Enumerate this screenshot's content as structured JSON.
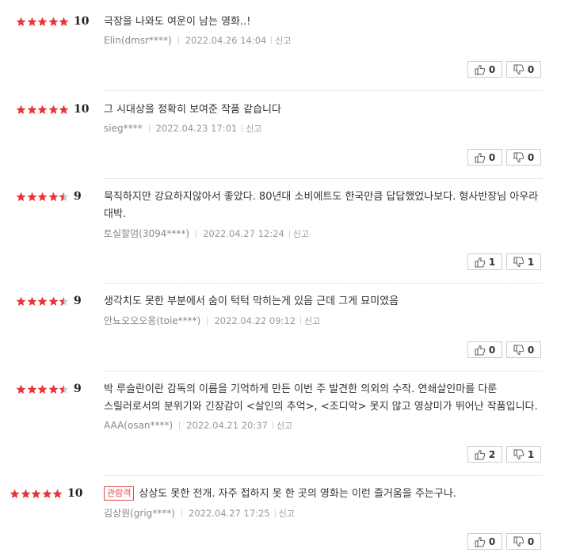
{
  "colors": {
    "star_full": "#e8343a",
    "star_empty": "#cccccc",
    "badge": "#e34b4b"
  },
  "icons": {
    "like": "thumbs-up-icon",
    "dislike": "thumbs-down-icon",
    "star": "star-icon",
    "half_star": "half-star-icon"
  },
  "reviews": [
    {
      "stars": 5,
      "score": "10",
      "text": "극장을 나와도 여운이 남는 영화..!",
      "user": "Elin(dmsr****)",
      "date": "2022.04.26 14:04",
      "report": "신고",
      "likes": "0",
      "dislikes": "0"
    },
    {
      "stars": 5,
      "score": "10",
      "text": "그 시대상을 정확히 보여준 작품 같습니다",
      "user": "sieg****",
      "date": "2022.04.23 17:01",
      "report": "신고",
      "likes": "0",
      "dislikes": "0"
    },
    {
      "stars": 4.5,
      "score": "9",
      "text": "묵직하지만 강요하지않아서 좋았다. 80년대 소비에트도 한국만큼 답답했었나보다. 형사반장님 아우라 대박.",
      "user": "토실할멈(3094****)",
      "date": "2022.04.27 12:24",
      "report": "신고",
      "likes": "1",
      "dislikes": "1"
    },
    {
      "stars": 4.5,
      "score": "9",
      "text": "생각치도 못한 부분에서 숨이 턱턱 막히는게 있음 근데 그게 묘미였음",
      "user": "안뇨오오오옹(toie****)",
      "date": "2022.04.22 09:12",
      "report": "신고",
      "likes": "0",
      "dislikes": "0"
    },
    {
      "stars": 4.5,
      "score": "9",
      "text": "박 루슬란이란 감독의 이름을 기억하게 만든 이번 주 발견한 의외의 수작. 연쇄살인마를 다룬 스릴러로서의 분위기와 긴장감이 <살인의 추억>, <조디악> 못지 않고 영상미가 뛰어난 작품입니다.",
      "user": "AAA(osan****)",
      "date": "2022.04.21 20:37",
      "report": "신고",
      "likes": "2",
      "dislikes": "1"
    },
    {
      "stars": 5,
      "score": "10",
      "badge": "관람객",
      "text": "상상도 못한 전개. 자주 접하지 못 한 곳의 영화는 이런 즐거움을 주는구나.",
      "user": "김상원(grig****)",
      "date": "2022.04.27 17:25",
      "report": "신고",
      "likes": "0",
      "dislikes": "0"
    }
  ]
}
